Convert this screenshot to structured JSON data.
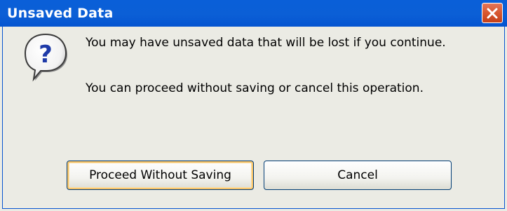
{
  "window": {
    "title": "Unsaved Data",
    "close_icon": "close-icon"
  },
  "message": {
    "icon": "question-icon",
    "line1": "You may have unsaved data that will be lost if you continue.",
    "line2": "You can proceed without saving or cancel this operation."
  },
  "buttons": {
    "proceed_label": "Proceed Without Saving",
    "cancel_label": "Cancel"
  },
  "colors": {
    "titlebar": "#0a5fd8",
    "close_button": "#d7572f",
    "dialog_background": "#ebebe4",
    "default_button_focus": "#f6c36a"
  }
}
